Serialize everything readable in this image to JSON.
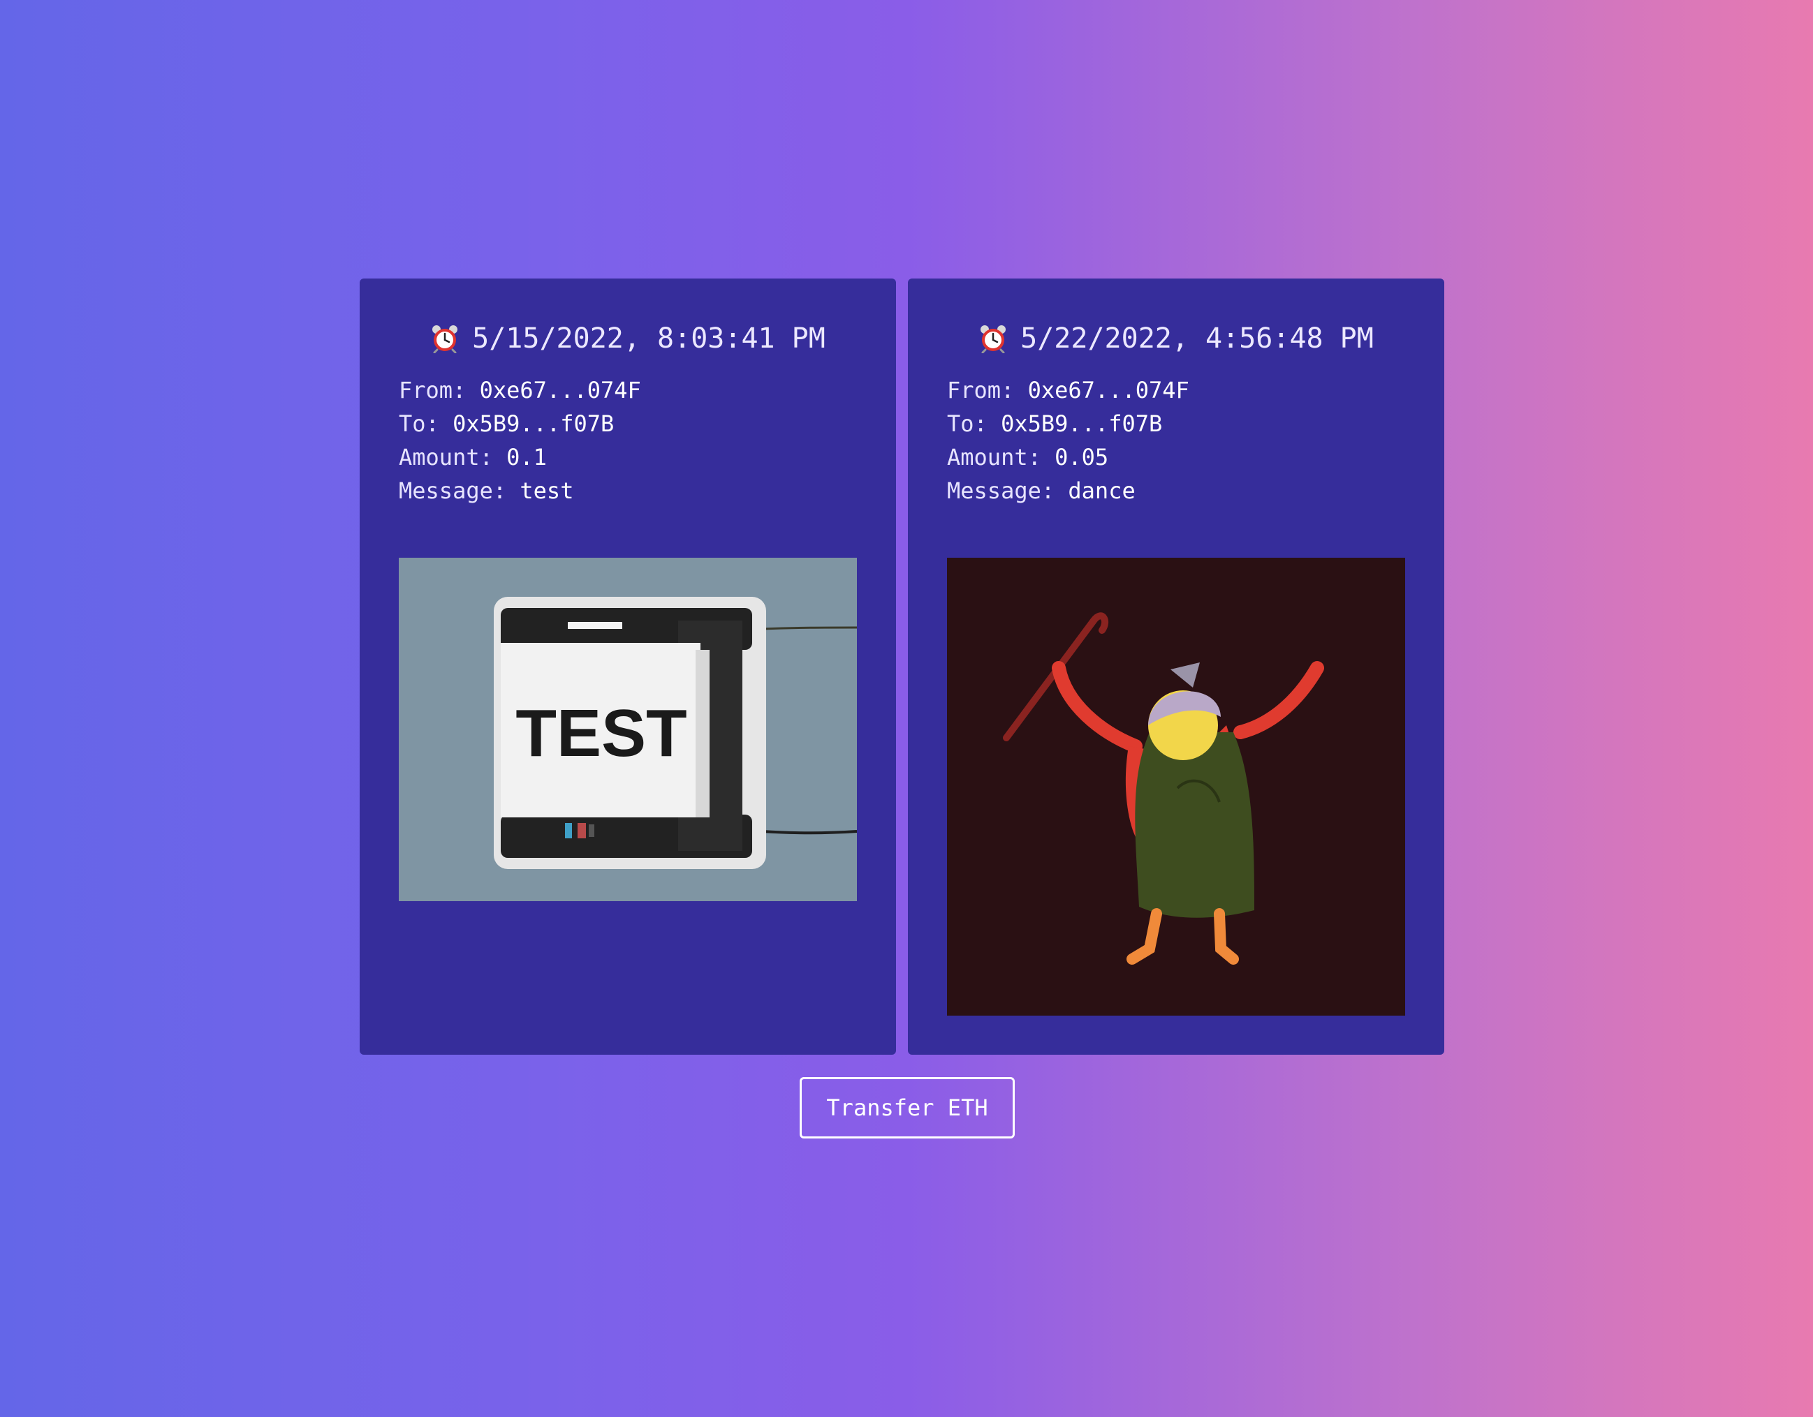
{
  "transactions": [
    {
      "timestamp": "5/15/2022, 8:03:41 PM",
      "from_label": "From:",
      "from": "0xe67...074F",
      "to_label": "To:",
      "to": "0x5B9...f07B",
      "amount_label": "Amount:",
      "amount": "0.1",
      "message_label": "Message:",
      "message": "test",
      "gif_text": "TEST"
    },
    {
      "timestamp": "5/22/2022, 4:56:48 PM",
      "from_label": "From:",
      "from": "0xe67...074F",
      "to_label": "To:",
      "to": "0x5B9...f07B",
      "amount_label": "Amount:",
      "amount": "0.05",
      "message_label": "Message:",
      "message": "dance"
    }
  ],
  "transfer_button_label": "Transfer ETH",
  "icons": {
    "timestamp_icon": "alarm-clock-icon"
  },
  "colors": {
    "card_background": "#362d9b",
    "button_border": "#ffffff"
  }
}
